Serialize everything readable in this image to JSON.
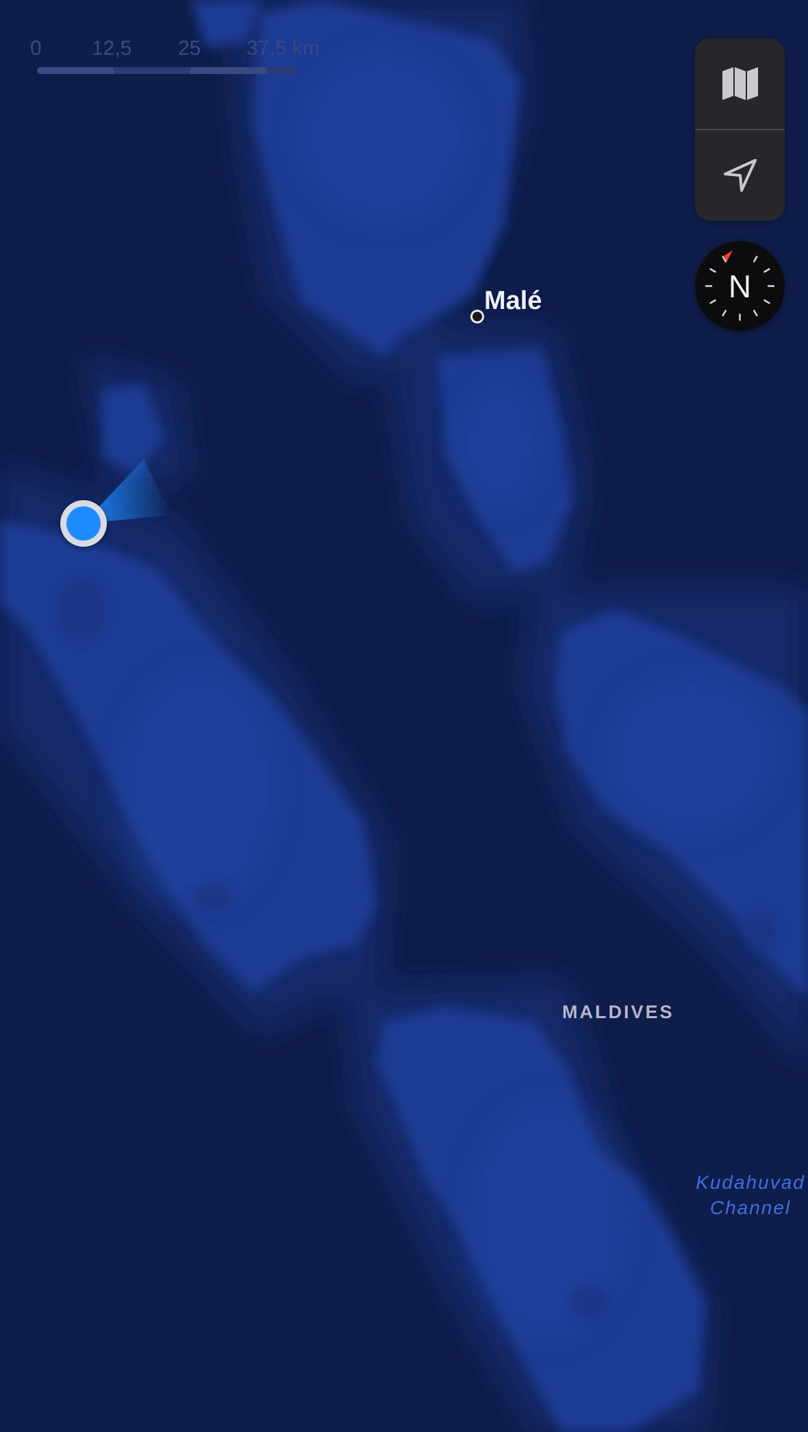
{
  "map": {
    "colors": {
      "deep_ocean": "#0f1d4a",
      "channel": "#16286b",
      "reef": "#1f3b93",
      "reef_light": "#2447a6",
      "user_dot": "#1e8bff",
      "compass_marker": "#ff3b30"
    },
    "scale_bar": {
      "labels": [
        "0",
        "12,5",
        "25",
        "37,5 km"
      ],
      "segment_colors": [
        "#3a4a83",
        "#2c3b72",
        "#3a4a83",
        "#2c3b72"
      ]
    },
    "controls": {
      "map_mode_icon": "map-icon",
      "locate_icon": "location-arrow-icon"
    },
    "compass": {
      "letter": "N"
    },
    "places": {
      "city": "Malé",
      "country": "MALDIVES",
      "water_line1": "Kudahuvad",
      "water_line2": "Channel"
    }
  }
}
